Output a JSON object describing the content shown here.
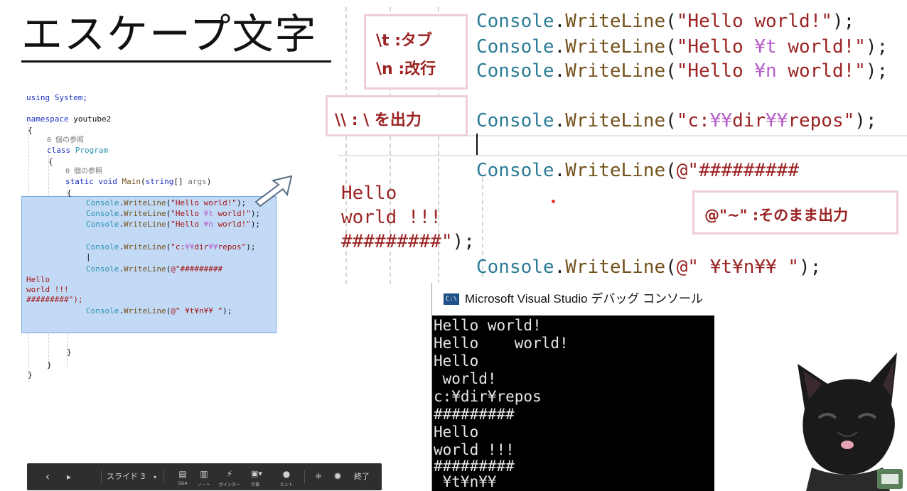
{
  "slide": {
    "title": "エスケープ文字"
  },
  "small_code": {
    "lines": [
      "using System;",
      "namespace youtube2",
      "{",
      "0 個の参照",
      "class Program",
      "{",
      "0 個の参照",
      "static void Main(string[] args)",
      "{",
      "Console.WriteLine(\"Hello world!\");",
      "Console.WriteLine(\"Hello ¥t world!\");",
      "Console.WriteLine(\"Hello ¥n world!\");",
      "Console.WriteLine(\"c:¥¥dir¥¥repos\");",
      "|",
      "Console.WriteLine(@\"#########",
      "Hello",
      "world !!!",
      "#########\");",
      "Console.WriteLine(@\" ¥t¥n¥¥ \");",
      "}",
      "}",
      "}"
    ]
  },
  "big_code": {
    "line1": "Console.WriteLine(\"Hello world!\");",
    "line2_pre": "Console.WriteLine(\"Hello ",
    "line2_esc": "¥t",
    "line2_post": " world!\");",
    "line3_pre": "Console.WriteLine(\"Hello ",
    "line3_esc": "¥n",
    "line3_post": " world!\");",
    "line4_pre": "Console.WriteLine(\"c:",
    "line4_esc1": "¥¥",
    "line4_mid": "dir",
    "line4_esc2": "¥¥",
    "line4_post": "repos\");",
    "line5": "Console.WriteLine(@\"#########",
    "verbatim_line1": "Hello",
    "verbatim_line2": "world !!!",
    "verbatim_line3": "#########\");",
    "line6": "Console.WriteLine(@\" ¥t¥n¥¥ \");"
  },
  "notes": {
    "tab": "\\t :タブ",
    "newline": "\\n :改行",
    "backslash": "\\\\ : \\ を出力",
    "verbatim": "@\"~\" :そのまま出力"
  },
  "console": {
    "title": "Microsoft Visual Studio デバッグ コンソール",
    "icon_text": "C:\\",
    "lines": [
      "Hello world!",
      "Hello    world!",
      "Hello",
      " world!",
      "c:¥dir¥repos",
      "#########",
      "Hello",
      "world !!!",
      "#########",
      " ¥t¥n¥¥"
    ]
  },
  "toolbar": {
    "prev": "‹",
    "next": "▸",
    "slide_label": "スライド 3",
    "qa": "Q&A",
    "note": "ノート",
    "pointer": "ポインター",
    "subtitle": "字幕",
    "hint": "ヒント",
    "end": "終了"
  },
  "colors": {
    "type": "#2c7c96",
    "method": "#73521d",
    "string": "#9b2323",
    "escape": "#b55cc8",
    "note_border": "#eccfd6",
    "selection": "#c3daf6"
  },
  "icons": [
    "prev-icon",
    "next-icon",
    "qa-icon",
    "note-icon",
    "pointer-icon",
    "subtitle-icon",
    "hint-icon",
    "expand-icon",
    "gear-icon",
    "arrow-icon",
    "presentation-icon"
  ]
}
